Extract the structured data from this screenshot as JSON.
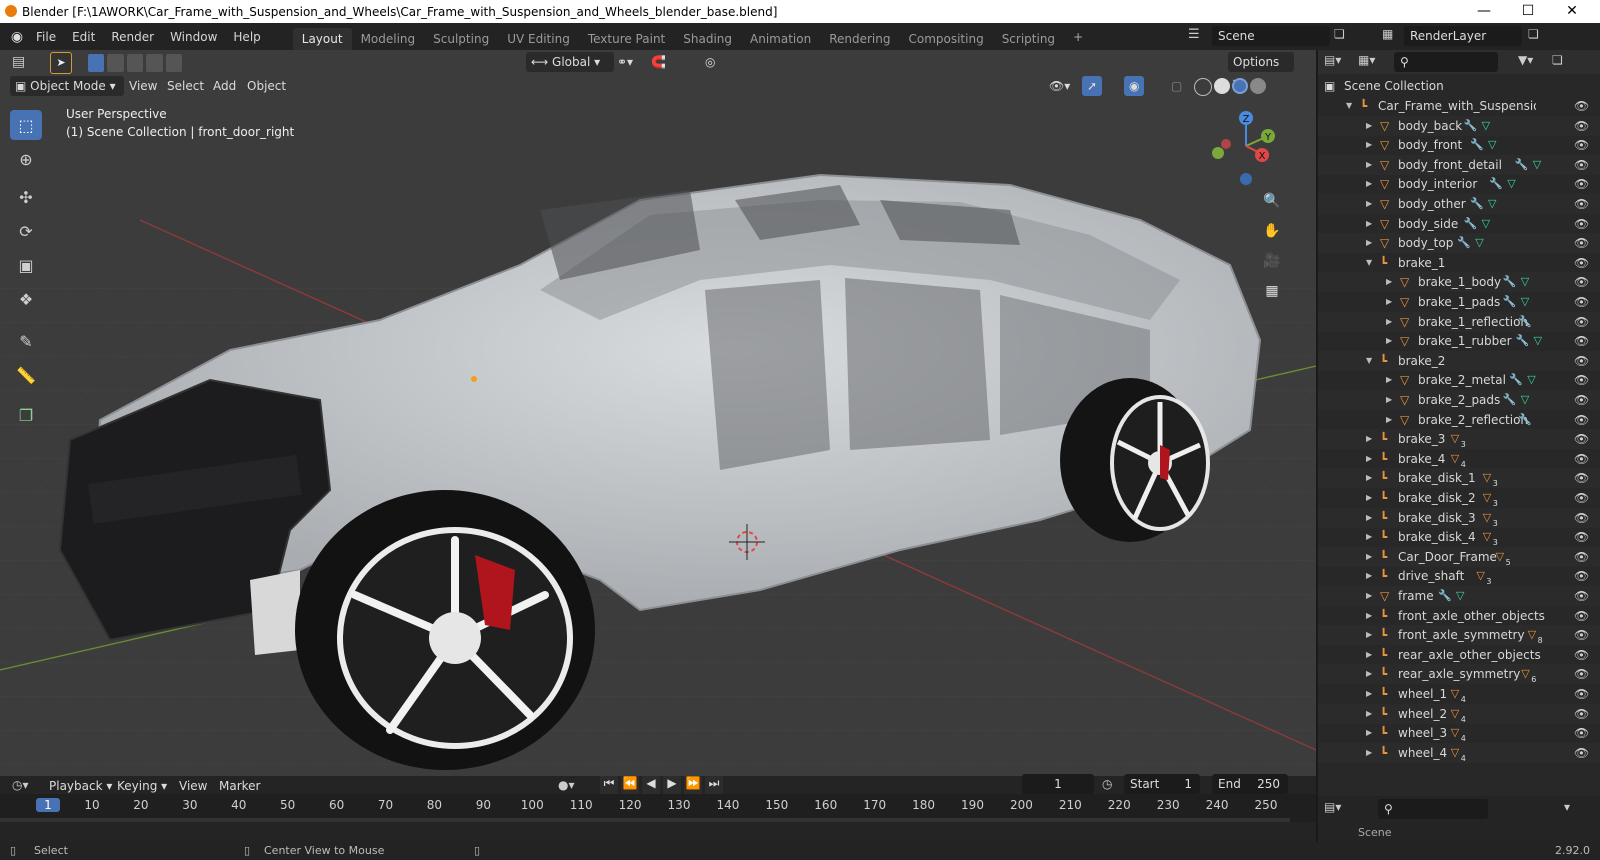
{
  "window": {
    "title": "Blender [F:\\1AWORK\\Car_Frame_with_Suspension_and_Wheels\\Car_Frame_with_Suspension_and_Wheels_blender_base.blend]",
    "minimize": "—",
    "maximize": "☐",
    "close": "✕"
  },
  "menus": [
    "File",
    "Edit",
    "Render",
    "Window",
    "Help"
  ],
  "workspaces": [
    "Layout",
    "Modeling",
    "Sculpting",
    "UV Editing",
    "Texture Paint",
    "Shading",
    "Animation",
    "Rendering",
    "Compositing",
    "Scripting"
  ],
  "workspace_add": "+",
  "scene": {
    "name": "Scene",
    "render_layer": "RenderLayer"
  },
  "header": {
    "orientation": "Global",
    "options": "Options",
    "mode": "Object Mode",
    "view": "View",
    "select": "Select",
    "add": "Add",
    "object": "Object"
  },
  "viewport": {
    "perspective": "User Perspective",
    "collection_info": "(1) Scene Collection | front_door_right",
    "gizmo": {
      "z": "Z",
      "y": "Y",
      "x": "X"
    }
  },
  "outliner": {
    "root": "Scene Collection",
    "rows": [
      {
        "name": "Car_Frame_with_Suspension_and_Wheels",
        "depth": 1,
        "expanded": true,
        "kind": "empty"
      },
      {
        "name": "body_back",
        "depth": 2,
        "kind": "mesh",
        "mods": "wrench+mesh"
      },
      {
        "name": "body_front",
        "depth": 2,
        "kind": "mesh",
        "mods": "wrench+mesh"
      },
      {
        "name": "body_front_detail",
        "depth": 2,
        "kind": "mesh",
        "mods": "wrench+mesh"
      },
      {
        "name": "body_interior",
        "depth": 2,
        "kind": "mesh",
        "mods": "wrench+mesh"
      },
      {
        "name": "body_other",
        "depth": 2,
        "kind": "mesh",
        "mods": "wrench+mesh"
      },
      {
        "name": "body_side",
        "depth": 2,
        "kind": "mesh",
        "mods": "wrench+mesh"
      },
      {
        "name": "body_top",
        "depth": 2,
        "kind": "mesh",
        "mods": "wrench+mesh"
      },
      {
        "name": "brake_1",
        "depth": 2,
        "expanded": true,
        "kind": "empty"
      },
      {
        "name": "brake_1_body",
        "depth": 3,
        "kind": "mesh",
        "mods": "wrench+mesh"
      },
      {
        "name": "brake_1_pads",
        "depth": 3,
        "kind": "mesh",
        "mods": "wrench+mesh"
      },
      {
        "name": "brake_1_reflection",
        "depth": 3,
        "kind": "mesh",
        "mods": "wrench"
      },
      {
        "name": "brake_1_rubber",
        "depth": 3,
        "kind": "mesh",
        "mods": "wrench+mesh"
      },
      {
        "name": "brake_2",
        "depth": 2,
        "expanded": true,
        "kind": "empty"
      },
      {
        "name": "brake_2_metal",
        "depth": 3,
        "kind": "mesh",
        "mods": "wrench+mesh"
      },
      {
        "name": "brake_2_pads",
        "depth": 3,
        "kind": "mesh",
        "mods": "wrench+mesh"
      },
      {
        "name": "brake_2_reflection",
        "depth": 3,
        "kind": "mesh",
        "mods": "wrench"
      },
      {
        "name": "brake_3",
        "depth": 2,
        "kind": "empty",
        "mods": "count",
        "count": "3"
      },
      {
        "name": "brake_4",
        "depth": 2,
        "kind": "empty",
        "mods": "count",
        "count": "4"
      },
      {
        "name": "brake_disk_1",
        "depth": 2,
        "kind": "empty",
        "mods": "count",
        "count": "3"
      },
      {
        "name": "brake_disk_2",
        "depth": 2,
        "kind": "empty",
        "mods": "count",
        "count": "3"
      },
      {
        "name": "brake_disk_3",
        "depth": 2,
        "kind": "empty",
        "mods": "count",
        "count": "3"
      },
      {
        "name": "brake_disk_4",
        "depth": 2,
        "kind": "empty",
        "mods": "count",
        "count": "3"
      },
      {
        "name": "Car_Door_Frame",
        "depth": 2,
        "kind": "empty",
        "mods": "count",
        "count": "5"
      },
      {
        "name": "drive_shaft",
        "depth": 2,
        "kind": "empty",
        "mods": "count",
        "count": "3"
      },
      {
        "name": "frame",
        "depth": 2,
        "kind": "mesh",
        "mods": "wrench+mesh"
      },
      {
        "name": "front_axle_other_objects",
        "depth": 2,
        "kind": "empty"
      },
      {
        "name": "front_axle_symmetry",
        "depth": 2,
        "kind": "empty",
        "mods": "count",
        "count": "8"
      },
      {
        "name": "rear_axle_other_objects",
        "depth": 2,
        "kind": "empty"
      },
      {
        "name": "rear_axle_symmetry",
        "depth": 2,
        "kind": "empty",
        "mods": "count",
        "count": "6"
      },
      {
        "name": "wheel_1",
        "depth": 2,
        "kind": "empty",
        "mods": "count",
        "count": "4"
      },
      {
        "name": "wheel_2",
        "depth": 2,
        "kind": "empty",
        "mods": "count",
        "count": "4"
      },
      {
        "name": "wheel_3",
        "depth": 2,
        "kind": "empty",
        "mods": "count",
        "count": "4"
      },
      {
        "name": "wheel_4",
        "depth": 2,
        "kind": "empty",
        "mods": "count",
        "count": "4"
      }
    ]
  },
  "properties": {
    "scene_label": "Scene"
  },
  "timeline": {
    "playback": "Playback",
    "keying": "Keying",
    "view": "View",
    "marker": "Marker",
    "current_frame": "1",
    "start_label": "Start",
    "start": "1",
    "end_label": "End",
    "end": "250",
    "ruler": [
      "1",
      "10",
      "20",
      "30",
      "40",
      "50",
      "60",
      "70",
      "80",
      "90",
      "100",
      "110",
      "120",
      "130",
      "140",
      "150",
      "160",
      "170",
      "180",
      "190",
      "200",
      "210",
      "220",
      "230",
      "240",
      "250"
    ]
  },
  "status": {
    "select": "Select",
    "center_view": "Center View to Mouse",
    "version": "2.92.0"
  },
  "colors": {
    "accent": "#4772b3",
    "mesh_icon": "#e8953a",
    "modifier_icon": "#4fa6e8",
    "data_icon": "#3dd69a"
  }
}
